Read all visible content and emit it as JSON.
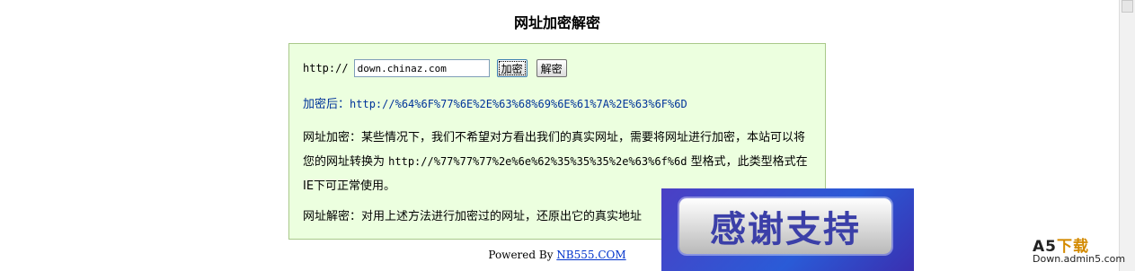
{
  "page": {
    "title": "网址加密解密"
  },
  "form": {
    "protocol_label": "http://",
    "url_value": "down.chinaz.com",
    "encrypt_label": "加密",
    "decrypt_label": "解密"
  },
  "result": {
    "label": "加密后：",
    "value": "http://%64%6F%77%6E%2E%63%68%69%6E%61%7A%2E%63%6F%6D"
  },
  "desc_encrypt": {
    "text1": "网址加密：某些情况下，我们不希望对方看出我们的真实网址，需要将网址进行加密，本站可以将您的网址转换为 ",
    "example": "http://%77%77%77%2e%6e%62%35%35%35%2e%63%6f%6d",
    "text2": " 型格式，此类型格式在IE下可正常使用。"
  },
  "desc_decrypt": {
    "text": "网址解密：对用上述方法进行加密过的网址，还原出它的真实地址"
  },
  "footer": {
    "prefix": "Powered By ",
    "link": "NB555.COM"
  },
  "overlay": {
    "banner": "感谢支持"
  },
  "watermark": {
    "brand_a": "A5",
    "brand_b": "下载",
    "domain": "Down.admin5.com"
  }
}
